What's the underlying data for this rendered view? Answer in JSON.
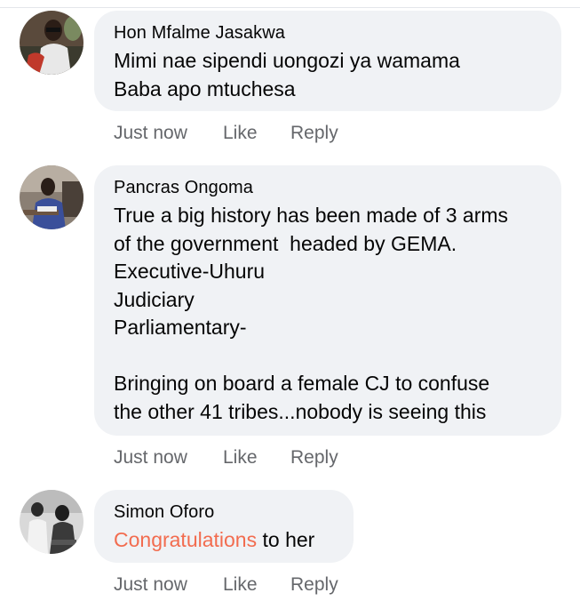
{
  "comments": [
    {
      "author": "Hon Mfalme Jasakwa",
      "lines": [
        "Mimi nae sipendi uongozi ya wamama",
        "Baba apo mtuchesa"
      ],
      "time": "Just now",
      "like_label": "Like",
      "reply_label": "Reply"
    },
    {
      "author": "Pancras Ongoma",
      "lines": [
        "True a big history has been made of 3 arms",
        "of the government  headed by GEMA.",
        "Executive-Uhuru",
        "Judiciary",
        "Parliamentary-",
        "",
        "Bringing on board a female CJ to confuse",
        "the other 41 tribes...nobody is seeing this"
      ],
      "time": "Just now",
      "like_label": "Like",
      "reply_label": "Reply"
    },
    {
      "author": "Simon Oforo",
      "mention": "Congratulations",
      "text_after_mention": " to her",
      "time": "Just now",
      "like_label": "Like",
      "reply_label": "Reply"
    }
  ],
  "colors": {
    "bubble": "#f0f2f5",
    "meta_text": "#65676b",
    "mention": "#f26c4f"
  }
}
